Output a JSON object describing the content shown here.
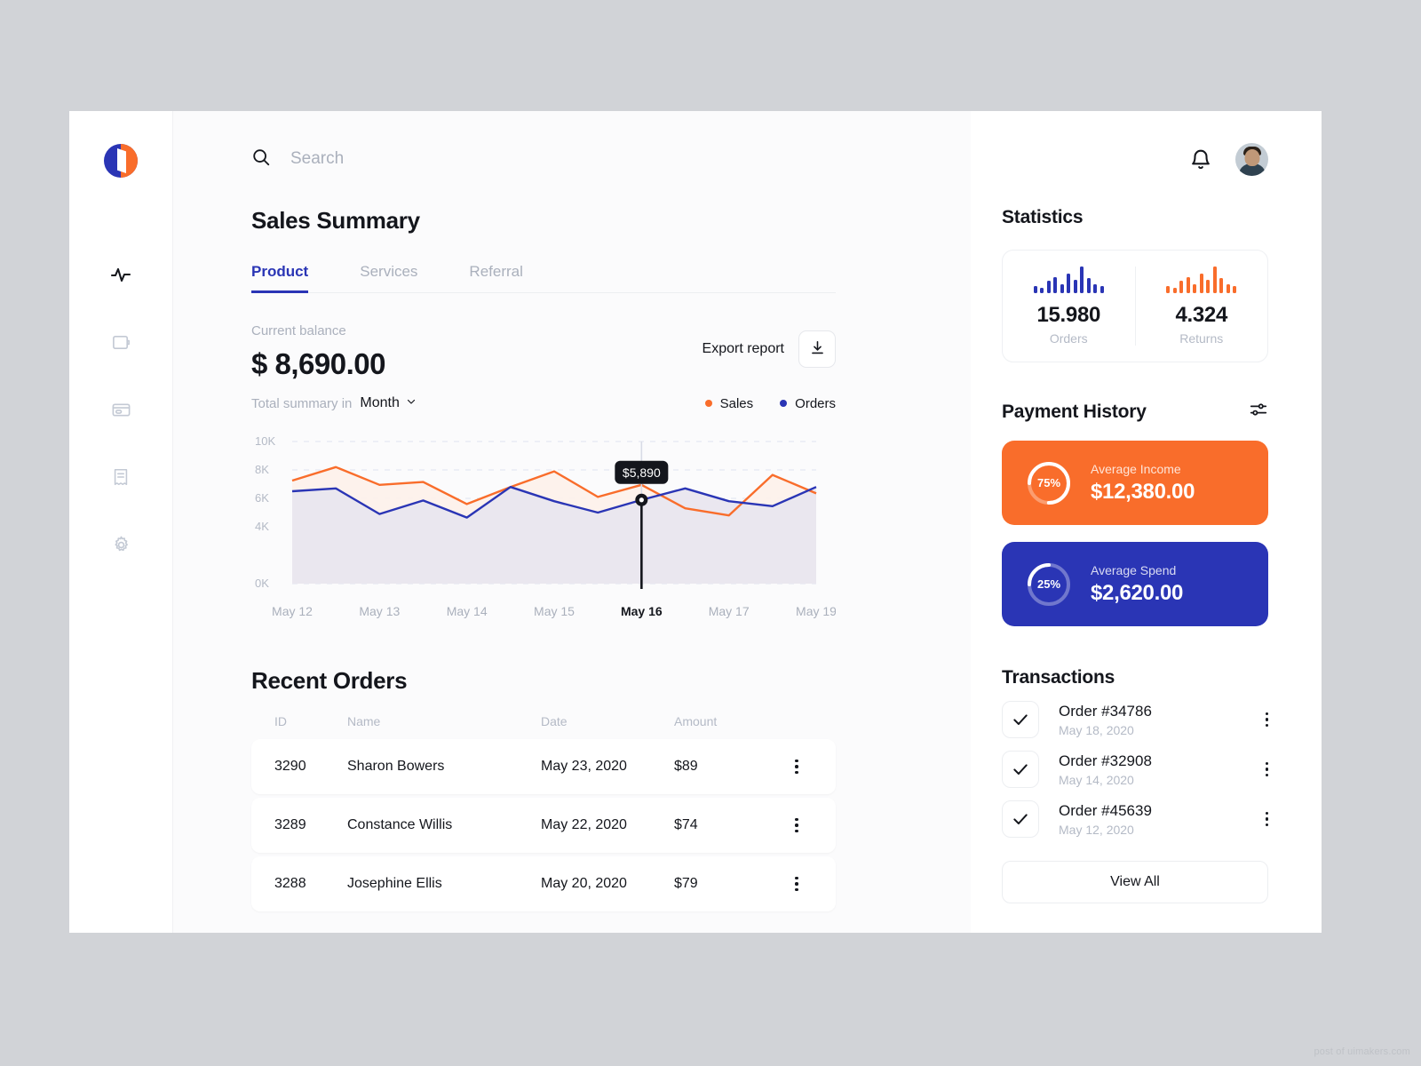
{
  "colors": {
    "brand_blue": "#2a35b5",
    "brand_orange": "#f96d2b",
    "muted": "#aab0bc",
    "text": "#14161c",
    "page_bg": "#d1d3d7"
  },
  "sidebar": {
    "logo_name": "app-logo",
    "items": [
      {
        "icon": "activity-pulse-icon",
        "label": "Activity",
        "active": true
      },
      {
        "icon": "wallet-icon",
        "label": "Wallet",
        "active": false
      },
      {
        "icon": "credit-card-icon",
        "label": "Cards",
        "active": false
      },
      {
        "icon": "receipt-icon",
        "label": "Invoices",
        "active": false
      },
      {
        "icon": "gear-icon",
        "label": "Settings",
        "active": false
      }
    ]
  },
  "topbar": {
    "search": {
      "value": "",
      "placeholder": "Search",
      "icon": "search-icon"
    },
    "bell_icon": "bell-icon",
    "avatar": "user-avatar"
  },
  "main": {
    "title": "Sales Summary",
    "tabs": [
      {
        "label": "Product",
        "active": true
      },
      {
        "label": "Services",
        "active": false
      },
      {
        "label": "Referral",
        "active": false
      }
    ],
    "balance_label": "Current balance",
    "balance_value": "$ 8,690.00",
    "export_label": "Export report",
    "export_icon": "download-icon",
    "summary_prefix": "Total summary in",
    "period_value": "Month",
    "period_icon": "chevron-down-icon",
    "legend": [
      {
        "label": "Sales",
        "color": "#f96d2b"
      },
      {
        "label": "Orders",
        "color": "#2a35b5"
      }
    ]
  },
  "chart_data": {
    "type": "line",
    "title": "Sales Summary",
    "xlabel": "",
    "ylabel": "",
    "grid": true,
    "legend_position": "top-right",
    "ylim": [
      0,
      10000
    ],
    "ytick_labels": [
      "10K",
      "8K",
      "6K",
      "4K",
      "0K"
    ],
    "yticks": [
      10000,
      8000,
      6000,
      4000,
      0
    ],
    "categories": [
      "May 12",
      "May 13",
      "May 14",
      "May 15",
      "May 16",
      "May 17",
      "May 19"
    ],
    "highlight_category": "May 16",
    "tooltip": {
      "label": "$5,890",
      "series": "Orders",
      "category": "May 16",
      "value": 5890
    },
    "series": [
      {
        "name": "Sales",
        "color": "#f96d2b",
        "fill": "#fdf1ea",
        "x": [
          0,
          0.5,
          1,
          1.5,
          2,
          2.5,
          3,
          3.5,
          4,
          4.5,
          5,
          5.5,
          6
        ],
        "values": [
          7250,
          8200,
          6950,
          7150,
          5600,
          6800,
          7900,
          6100,
          6950,
          5300,
          4800,
          7650,
          6350
        ]
      },
      {
        "name": "Orders",
        "color": "#2a35b5",
        "fill": "#e9e6ef",
        "x": [
          0,
          0.5,
          1,
          1.5,
          2,
          2.5,
          3,
          3.5,
          4,
          4.5,
          5,
          5.5,
          6
        ],
        "values": [
          6500,
          6700,
          4900,
          5850,
          4650,
          6800,
          5800,
          5000,
          5890,
          6700,
          5800,
          5450,
          6800
        ]
      }
    ]
  },
  "orders": {
    "title": "Recent Orders",
    "columns": [
      "ID",
      "Name",
      "Date",
      "Amount"
    ],
    "rows": [
      {
        "id": "3290",
        "name": "Sharon Bowers",
        "date": "May 23, 2020",
        "amount": "$89"
      },
      {
        "id": "3289",
        "name": "Constance Willis",
        "date": "May 22, 2020",
        "amount": "$74"
      },
      {
        "id": "3288",
        "name": "Josephine Ellis",
        "date": "May 20, 2020",
        "amount": "$79"
      }
    ],
    "row_menu_icon": "kebab-menu-icon"
  },
  "statistics": {
    "title": "Statistics",
    "cards": [
      {
        "value": "15.980",
        "label": "Orders",
        "color": "#2a35b5",
        "spark": [
          7,
          5,
          12,
          16,
          9,
          19,
          13,
          26,
          15,
          9,
          7
        ]
      },
      {
        "value": "4.324",
        "label": "Returns",
        "color": "#f96d2b",
        "spark": [
          7,
          5,
          12,
          16,
          9,
          19,
          13,
          26,
          15,
          9,
          7
        ]
      }
    ]
  },
  "payment_history": {
    "title": "Payment History",
    "filter_icon": "sliders-icon",
    "cards": [
      {
        "percent": "75%",
        "percent_value": 75,
        "label": "Average Income",
        "value": "$12,380.00",
        "bg": "#f96d2b"
      },
      {
        "percent": "25%",
        "percent_value": 25,
        "label": "Average Spend",
        "value": "$2,620.00",
        "bg": "#2a35b5"
      }
    ]
  },
  "transactions": {
    "title": "Transactions",
    "items": [
      {
        "title": "Order #34786",
        "date": "May 18, 2020",
        "checked": true
      },
      {
        "title": "Order #32908",
        "date": "May 14, 2020",
        "checked": true
      },
      {
        "title": "Order #45639",
        "date": "May 12, 2020",
        "checked": true
      }
    ],
    "view_all_label": "View All",
    "check_icon": "check-icon",
    "menu_icon": "kebab-menu-icon"
  },
  "watermark": "post of uimakers.com"
}
